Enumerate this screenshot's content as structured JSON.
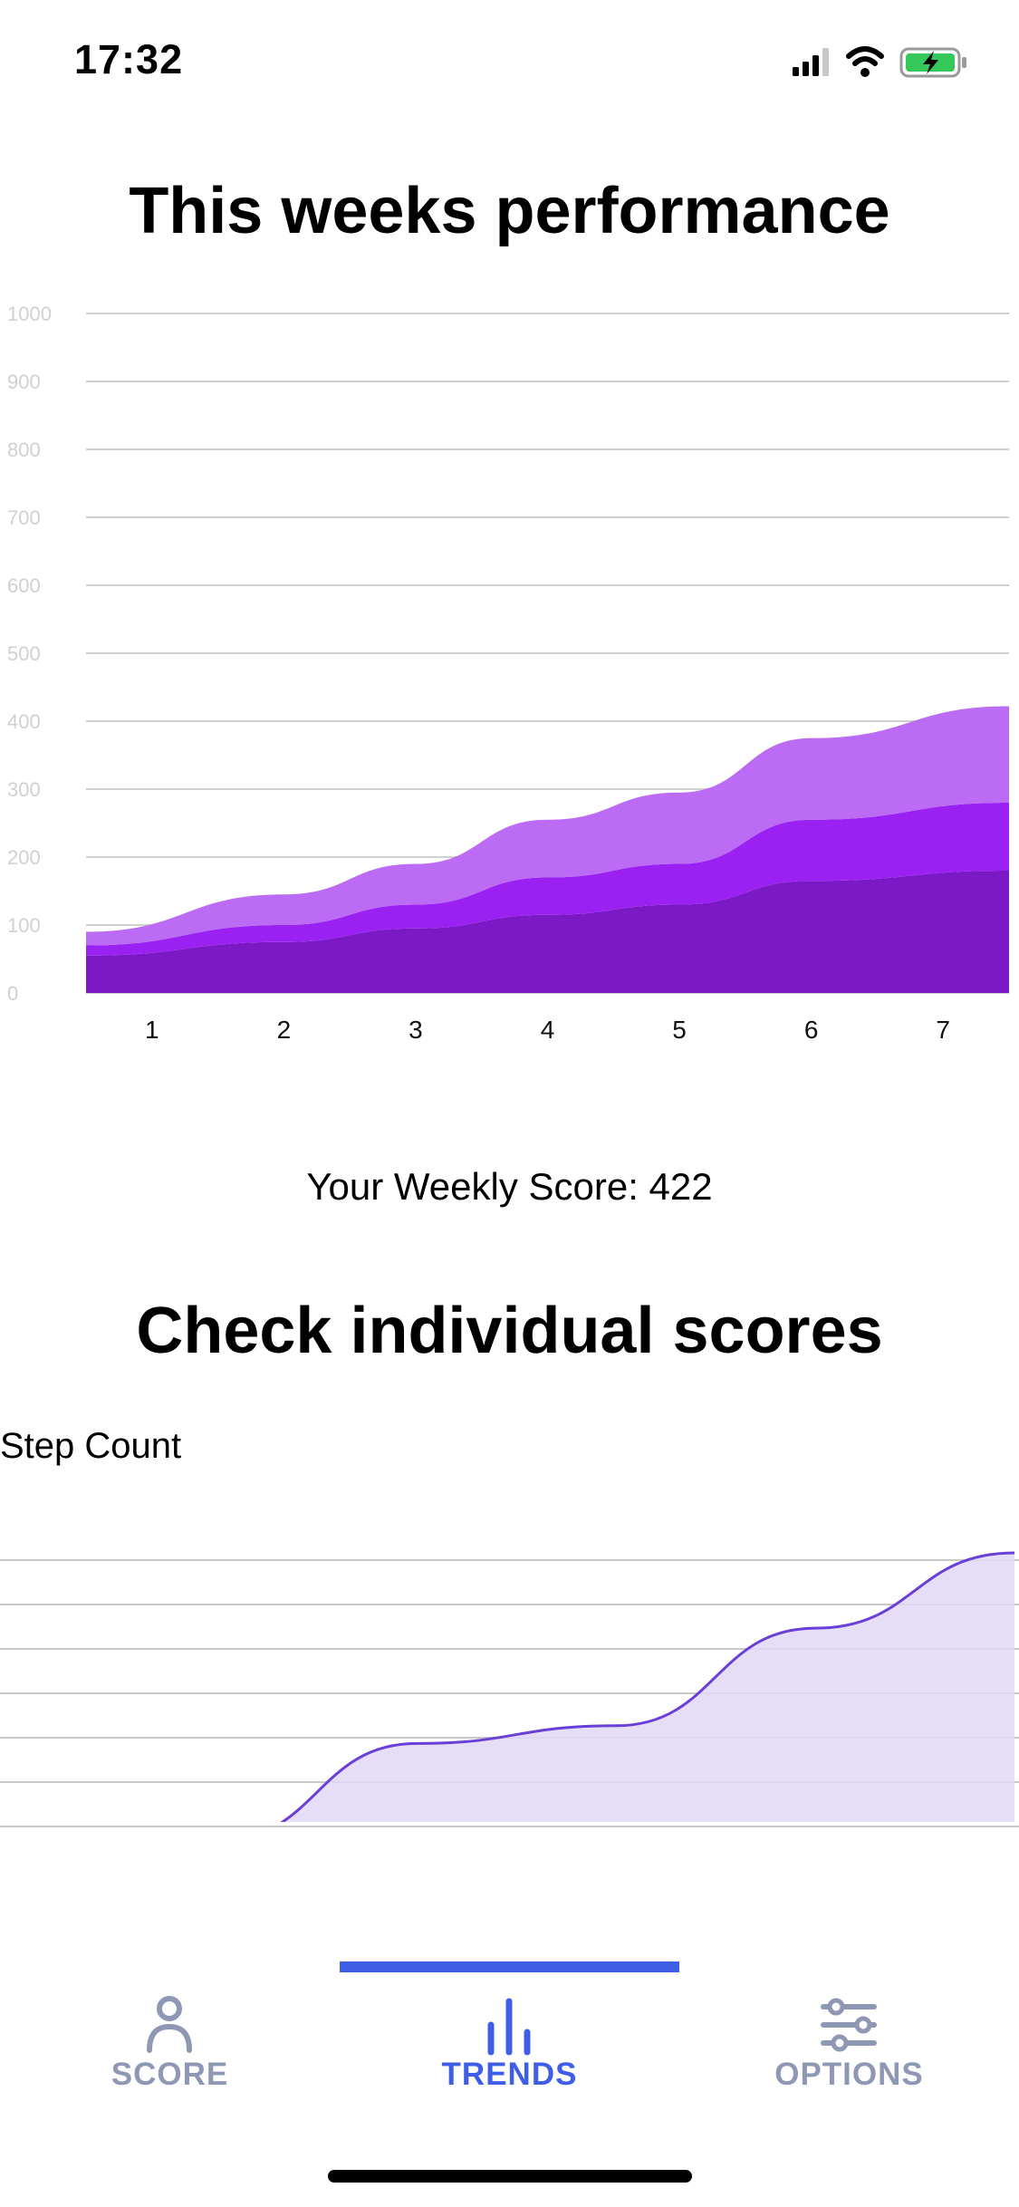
{
  "status_bar": {
    "time": "17:32",
    "icons": [
      "cellular-signal-icon",
      "wifi-icon",
      "battery-charging-icon"
    ]
  },
  "main_title": "This weeks performance",
  "chart_data": [
    {
      "type": "area",
      "stacked": true,
      "x": [
        1,
        2,
        3,
        4,
        5,
        6,
        7
      ],
      "ylim": [
        0,
        1000
      ],
      "yticks": [
        0,
        100,
        200,
        300,
        400,
        500,
        600,
        700,
        800,
        900,
        1000
      ],
      "grid": true,
      "legend": "none",
      "colors": [
        "#7c19c6",
        "#9a21f2",
        "#bc6cf4"
      ],
      "series": [
        {
          "values": [
            55,
            75,
            95,
            115,
            130,
            165,
            180
          ]
        },
        {
          "values": [
            15,
            25,
            35,
            55,
            60,
            90,
            100
          ]
        },
        {
          "values": [
            20,
            45,
            60,
            85,
            105,
            120,
            142
          ]
        }
      ]
    },
    {
      "type": "area",
      "title": "Step Count",
      "x": [
        1,
        2,
        3,
        4,
        5,
        6,
        7
      ],
      "values": [
        0,
        0,
        0,
        2.2,
        2.6,
        4.8,
        6.5
      ],
      "ylim": [
        0,
        6.5
      ],
      "grid": true,
      "legend": "none",
      "colors": [
        "#6a3fd7",
        "#e2d8f6"
      ]
    }
  ],
  "weekly_score": "Your Weekly Score: 422",
  "section_title": "Check individual scores",
  "step_label": "Step Count",
  "tabs": [
    {
      "label": "SCORE",
      "icon": "person-icon",
      "active": false
    },
    {
      "label": "TRENDS",
      "icon": "bar-chart-icon",
      "active": true
    },
    {
      "label": "OPTIONS",
      "icon": "sliders-icon",
      "active": false
    }
  ],
  "colors": {
    "accent": "#3e5ee6",
    "inactive": "#8e97b3"
  }
}
